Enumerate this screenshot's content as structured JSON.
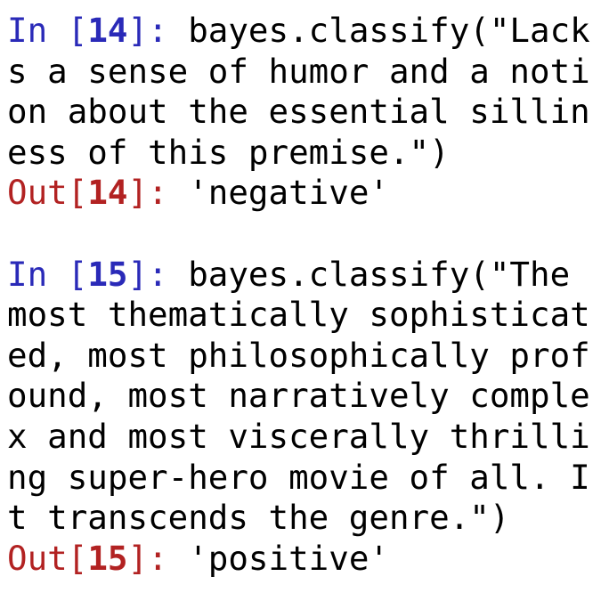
{
  "colors": {
    "in_prompt": "#2a2ab8",
    "out_prompt": "#b22222",
    "text": "#000000",
    "background": "#ffffff"
  },
  "cells": [
    {
      "in_label": "In [",
      "in_number": "14",
      "in_close": "]: ",
      "input_lines": [
        "bayes.classify(\"Lack",
        "s a sense of humor and a noti",
        "on about the essential sillin",
        "ess of this premise.\")"
      ],
      "out_label": "Out[",
      "out_number": "14",
      "out_close": "]: ",
      "output": "'negative'"
    },
    {
      "in_label": "In [",
      "in_number": "15",
      "in_close": "]: ",
      "input_lines": [
        "bayes.classify(\"The",
        "most thematically sophisticat",
        "ed, most philosophically prof",
        "ound, most narratively comple",
        "x and most viscerally thrilli",
        "ng super-hero movie of all. I",
        "t transcends the genre.\")"
      ],
      "out_label": "Out[",
      "out_number": "15",
      "out_close": "]: ",
      "output": "'positive'"
    }
  ]
}
